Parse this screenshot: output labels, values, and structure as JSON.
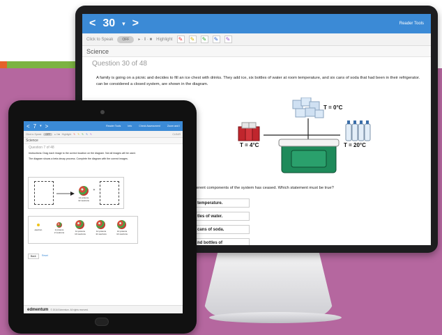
{
  "monitor": {
    "nav": {
      "prev": "<",
      "question_number": "30",
      "dropdown": "▾",
      "next": ">",
      "reader_tools": "Reader Tools"
    },
    "toolbar": {
      "click_to_speak": "Click to Speak",
      "toggle": "OFF",
      "highlight": "Highlight"
    },
    "subject": "Science",
    "question_title": "Question 30 of 48",
    "stem": "A family is going on a picnic and decides to fill an ice chest with drinks. They add ice, six bottles of water at room temperature, and six cans of soda that had been in their refrigerator. can be considered a closed system, are shown in the diagram.",
    "stem_continued": "ne different components of the system has ceased. Which statement must be true?",
    "diagram": {
      "t_ice": "T = 0°C",
      "t_soda": "T = 4°C",
      "t_water": "T = 20°C"
    },
    "options": [
      "temperature.",
      "tles of water.",
      "cans of soda.",
      "nd bottles of"
    ]
  },
  "tablet": {
    "nav": {
      "prev": "<",
      "question_number": "7",
      "dropdown": "▾",
      "next": ">",
      "reader_tools": "Reader Tools",
      "info": "Info",
      "check_assessment": "Check Assessment",
      "zoom": "Zoom and I"
    },
    "toolbar": {
      "click_to_speak": "Click to Speak",
      "toggle": "OFF",
      "highlight": "Highlight",
      "clear": "CLEAR"
    },
    "subject": "Science",
    "question_title": "Question 7 of 48",
    "instructions": "Instructions: Drag each image to the correct location on the diagram. Not all images will be used.",
    "prompt": "The diagram shows a beta decay process. Complete the diagram with the correct images.",
    "diagram_label": "12 protons\n12 neutrons",
    "plus": "+",
    "choices": [
      {
        "label": "electron"
      },
      {
        "label": "2 protons\n2 neutrons"
      },
      {
        "label": "11 protons\n13 neutrons"
      },
      {
        "label": "12 protons\n11 neutrons"
      },
      {
        "label": "14 protons\n14 neutrons"
      }
    ],
    "buttons": {
      "back": "Back",
      "reset": "Reset"
    },
    "footer": {
      "brand": "edmentum",
      "copyright": "© 2016 Edmentum. All rights reserved."
    }
  },
  "colors": {
    "accent": "#3b8ad6",
    "background": "#b5679f",
    "stripe_orange": "#e5622a",
    "stripe_green": "#7cb342"
  }
}
